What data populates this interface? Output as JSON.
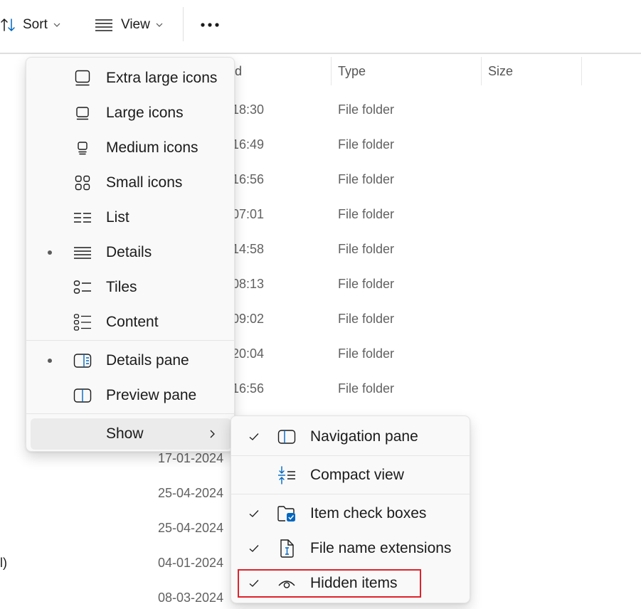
{
  "toolbar": {
    "sort_label": "Sort",
    "view_label": "View",
    "icons": {
      "sort": "sort-arrows-icon",
      "view": "lines-icon",
      "more": "ellipsis-icon"
    }
  },
  "file_list": {
    "columns": [
      {
        "label": "d"
      },
      {
        "label": "Type"
      },
      {
        "label": "Size"
      }
    ],
    "rows": [
      {
        "modified": "18:30",
        "type": "File folder"
      },
      {
        "modified": "16:49",
        "type": "File folder"
      },
      {
        "modified": "16:56",
        "type": "File folder"
      },
      {
        "modified": "07:01",
        "type": "File folder"
      },
      {
        "modified": "14:58",
        "type": "File folder"
      },
      {
        "modified": "08:13",
        "type": "File folder"
      },
      {
        "modified": "09:02",
        "type": "File folder"
      },
      {
        "modified": "20:04",
        "type": "File folder"
      },
      {
        "modified": "16:56",
        "type": "File folder"
      }
    ],
    "lower_rows": [
      {
        "date": "17-01-2024",
        "name_fragment": ""
      },
      {
        "date": "25-04-2024",
        "name_fragment": ""
      },
      {
        "date": "25-04-2024",
        "name_fragment": ""
      },
      {
        "date": "04-01-2024",
        "name_fragment": "l)"
      },
      {
        "date": "08-03-2024",
        "name_fragment": ""
      }
    ]
  },
  "view_menu": {
    "layout_items": [
      {
        "label": "Extra large icons",
        "icon": "monitor-xl-icon",
        "selected": false
      },
      {
        "label": "Large icons",
        "icon": "monitor-large-icon",
        "selected": false
      },
      {
        "label": "Medium icons",
        "icon": "monitor-medium-icon",
        "selected": false
      },
      {
        "label": "Small icons",
        "icon": "grid-small-icons-icon",
        "selected": false
      },
      {
        "label": "List",
        "icon": "list-icon",
        "selected": false
      },
      {
        "label": "Details",
        "icon": "details-lines-icon",
        "selected": true
      },
      {
        "label": "Tiles",
        "icon": "tiles-icon",
        "selected": false
      },
      {
        "label": "Content",
        "icon": "content-icon",
        "selected": false
      }
    ],
    "pane_items": [
      {
        "label": "Details pane",
        "icon": "details-pane-icon",
        "selected": true
      },
      {
        "label": "Preview pane",
        "icon": "preview-pane-icon",
        "selected": false
      }
    ],
    "show_label": "Show"
  },
  "show_menu": {
    "items": [
      {
        "label": "Navigation pane",
        "icon": "navigation-pane-icon",
        "checked": true
      },
      {
        "label": "Compact view",
        "icon": "compact-view-icon",
        "checked": false
      },
      {
        "label": "Item check boxes",
        "icon": "item-checkbox-icon",
        "checked": true
      },
      {
        "label": "File name extensions",
        "icon": "file-extension-icon",
        "checked": true
      },
      {
        "label": "Hidden items",
        "icon": "eye-icon",
        "checked": true
      }
    ],
    "highlight_color": "#e0222a"
  },
  "colors": {
    "accent": "#0067c0",
    "menu_bg": "#f9f9f9",
    "hover_bg": "#ebebeb"
  }
}
